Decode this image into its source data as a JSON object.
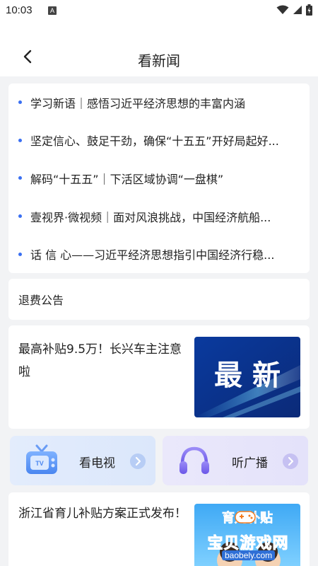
{
  "status": {
    "time": "10:03",
    "notif": "A"
  },
  "header": {
    "title": "看新闻"
  },
  "news": [
    "学习新语｜感悟习近平经济思想的丰富内涵",
    "坚定信心、鼓足干劲，确保“十五五”开好局起好...",
    "解码“十五五”｜下活区域协调“一盘棋”",
    "壹视界·微视频｜面对风浪挑战，中国经济航船...",
    "话 信 心——习近平经济思想指引中国经济行稳..."
  ],
  "notice": {
    "label": "退费公告"
  },
  "feature": {
    "text": "最高补贴9.5万！长兴车主注意啦",
    "image_text": "最 新"
  },
  "tiles": {
    "tv": "看电视",
    "radio": "听广播"
  },
  "feature2": {
    "text": "浙江省育儿补贴方案正式发布！",
    "image_text": "育儿补贴"
  },
  "watermark": {
    "title": "宝贝游戏网",
    "url": "baobely.com"
  },
  "colors": {
    "accent": "#3a6ff2",
    "background": "#f2f3f5"
  }
}
